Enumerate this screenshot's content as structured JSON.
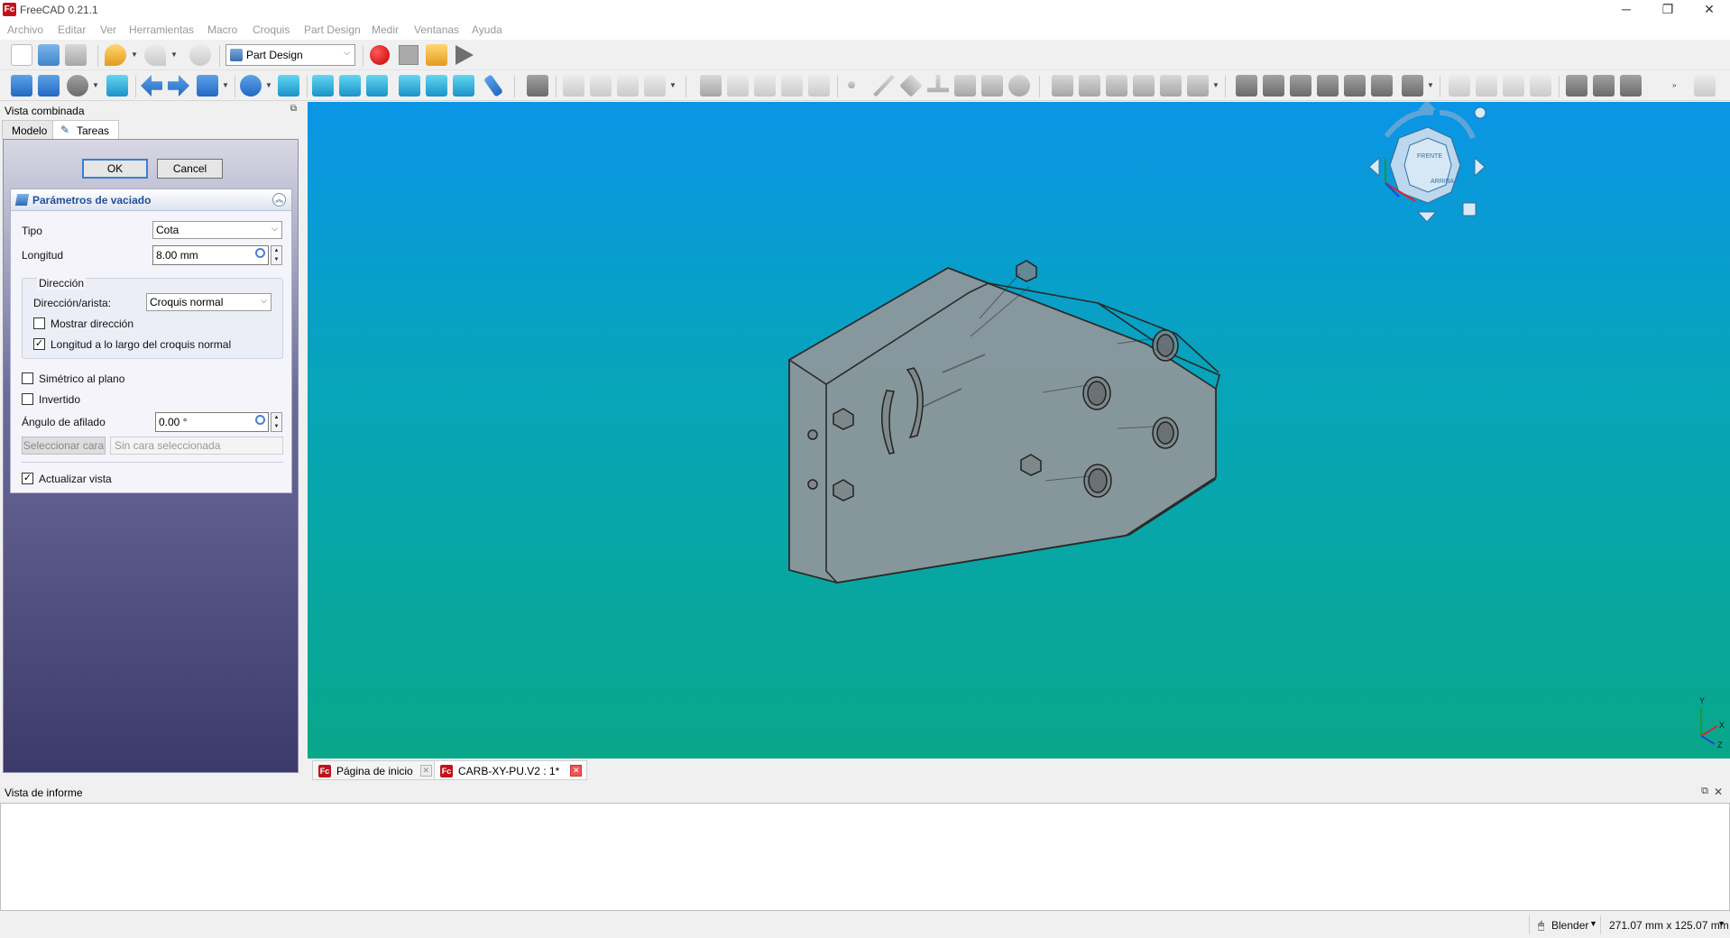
{
  "window": {
    "title": "FreeCAD 0.21.1",
    "app_logo_text": "Fc",
    "minimize": "─",
    "restore": "❐",
    "close": "✕"
  },
  "menubar": {
    "items": [
      "Archivo",
      "Editar",
      "Ver",
      "Herramientas",
      "Macro",
      "Croquis",
      "Part Design",
      "Medir",
      "Ventanas",
      "Ayuda"
    ]
  },
  "toolbar": {
    "workbench": "Part Design"
  },
  "left_panel": {
    "title": "Vista combinada",
    "tabs": [
      "Modelo",
      "Tareas"
    ],
    "active_tab": "Tareas",
    "ok_label": "OK",
    "cancel_label": "Cancel",
    "pocket": {
      "title": "Parámetros de vaciado",
      "tipo_label": "Tipo",
      "tipo_value": "Cota",
      "longitud_label": "Longitud",
      "longitud_value": "8.00 mm",
      "direccion_group": "Dirección",
      "dir_arista_label": "Dirección/arista:",
      "dir_arista_value": "Croquis normal",
      "mostrar_direccion": "Mostrar dirección",
      "mostrar_direccion_checked": false,
      "longitud_largo": "Longitud a lo largo del croquis normal",
      "longitud_largo_checked": true,
      "simetrico": "Simétrico al plano",
      "simetrico_checked": false,
      "invertido": "Invertido",
      "invertido_checked": false,
      "angulo_label": "Ángulo de afilado",
      "angulo_value": "0.00 °",
      "seleccionar_cara": "Seleccionar cara",
      "sin_cara": "Sin cara seleccionada",
      "actualizar_vista": "Actualizar vista",
      "actualizar_vista_checked": true
    }
  },
  "viewport": {
    "navcube_faces": [
      "FRENTE",
      "ARRIBA"
    ],
    "axis_labels": [
      "Y",
      "X",
      "Z"
    ],
    "tabs": [
      {
        "label": "Página de inicio",
        "active": false
      },
      {
        "label": "CARB-XY-PU.V2 : 1*",
        "active": true
      }
    ]
  },
  "report": {
    "title": "Vista de informe",
    "content": ""
  },
  "statusbar": {
    "nav_style": "Blender",
    "dimensions": "271.07 mm x 125.07 mm"
  },
  "colors": {
    "viewport_top": "#0a95e6",
    "viewport_bottom": "#08a78a",
    "task_panel": "#3b3a6a",
    "accent": "#23509a"
  }
}
